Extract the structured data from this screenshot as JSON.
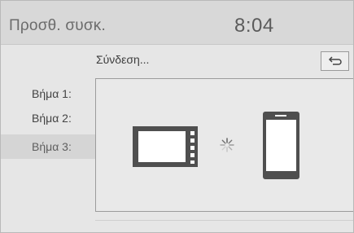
{
  "header": {
    "title": "Προσθ. συσκ.",
    "time": "8:04"
  },
  "subheader": {
    "label": "Σύνδεση..."
  },
  "back_button": {
    "icon": "return-arrow-icon"
  },
  "steps": [
    {
      "label": "Βήμα 1:"
    },
    {
      "label": "Βήμα 2:"
    },
    {
      "label": "Βήμα 3:",
      "active": true
    }
  ],
  "connection": {
    "head_unit_icon": "head-unit-display-icon",
    "status_icon": "loading-spinner-icon",
    "phone_icon": "smartphone-icon"
  },
  "colors": {
    "icon": "#4f4f4f",
    "active_step_bg": "#d5d5d5"
  }
}
